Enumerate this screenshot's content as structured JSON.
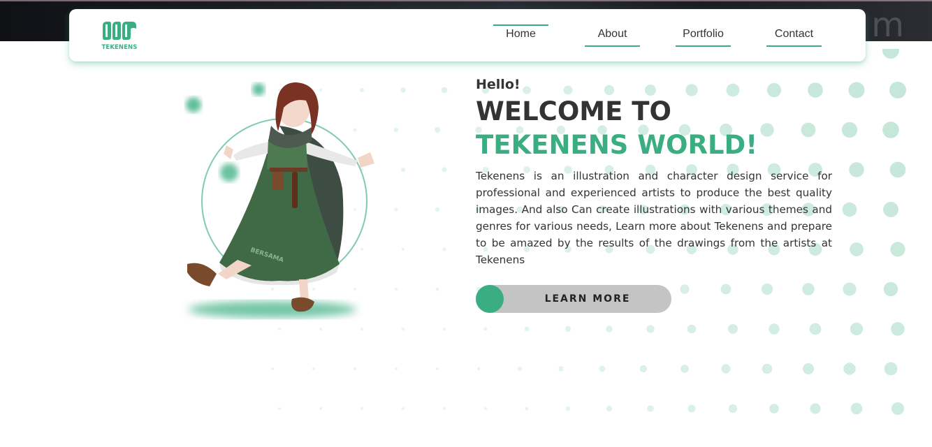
{
  "brand": {
    "name": "TEKENENS",
    "accent": "#3aae82"
  },
  "nav": {
    "items": [
      {
        "label": "Home",
        "active": true
      },
      {
        "label": "About",
        "active": false
      },
      {
        "label": "Portfolio",
        "active": false
      },
      {
        "label": "Contact",
        "active": false
      }
    ]
  },
  "hero": {
    "greeting": "Hello!",
    "title_line1": "WELCOME TO",
    "title_line2": "TEKENENS WORLD!",
    "description": "Tekenens is an illustration and character design service for professional and experienced artists to produce the best quality images. And also Can create illustrations with various themes and genres for various needs, Learn more about Tekenens and prepare to be amazed by the results of the drawings from the artists at Tekenens",
    "cta_label": "LEARN MORE",
    "illustration_tag": "BERSAMA",
    "illustration_icon": "character-illustration"
  },
  "colors": {
    "accent": "#3aae82",
    "text": "#333333",
    "button_bg": "#c4c4c4"
  }
}
